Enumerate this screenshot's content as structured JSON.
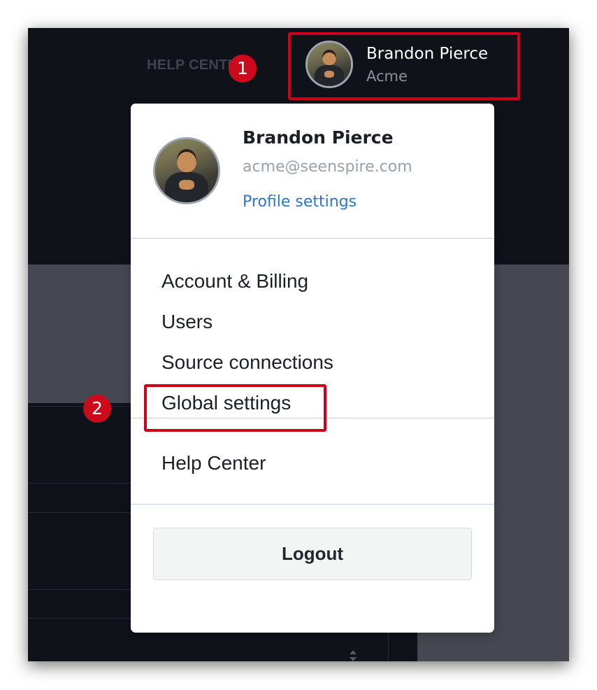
{
  "header": {
    "help_center_label": "HELP CENTER",
    "user_name": "Brandon Pierce",
    "user_org": "Acme"
  },
  "menu": {
    "name": "Brandon Pierce",
    "email": "acme@seenspire.com",
    "profile_link": "Profile settings",
    "items": [
      {
        "label": "Account & Billing"
      },
      {
        "label": "Users"
      },
      {
        "label": "Source connections"
      },
      {
        "label": "Global settings"
      }
    ],
    "help_center": "Help Center",
    "logout": "Logout"
  },
  "annotations": {
    "step1": "1",
    "step2": "2",
    "highlight_color": "#d0001a"
  },
  "colors": {
    "app_background": "#10121a",
    "panel_gray": "#454850",
    "link_blue": "#2a76d2"
  },
  "icons": {
    "sort": "sort-icon",
    "avatar": "avatar-photo"
  }
}
